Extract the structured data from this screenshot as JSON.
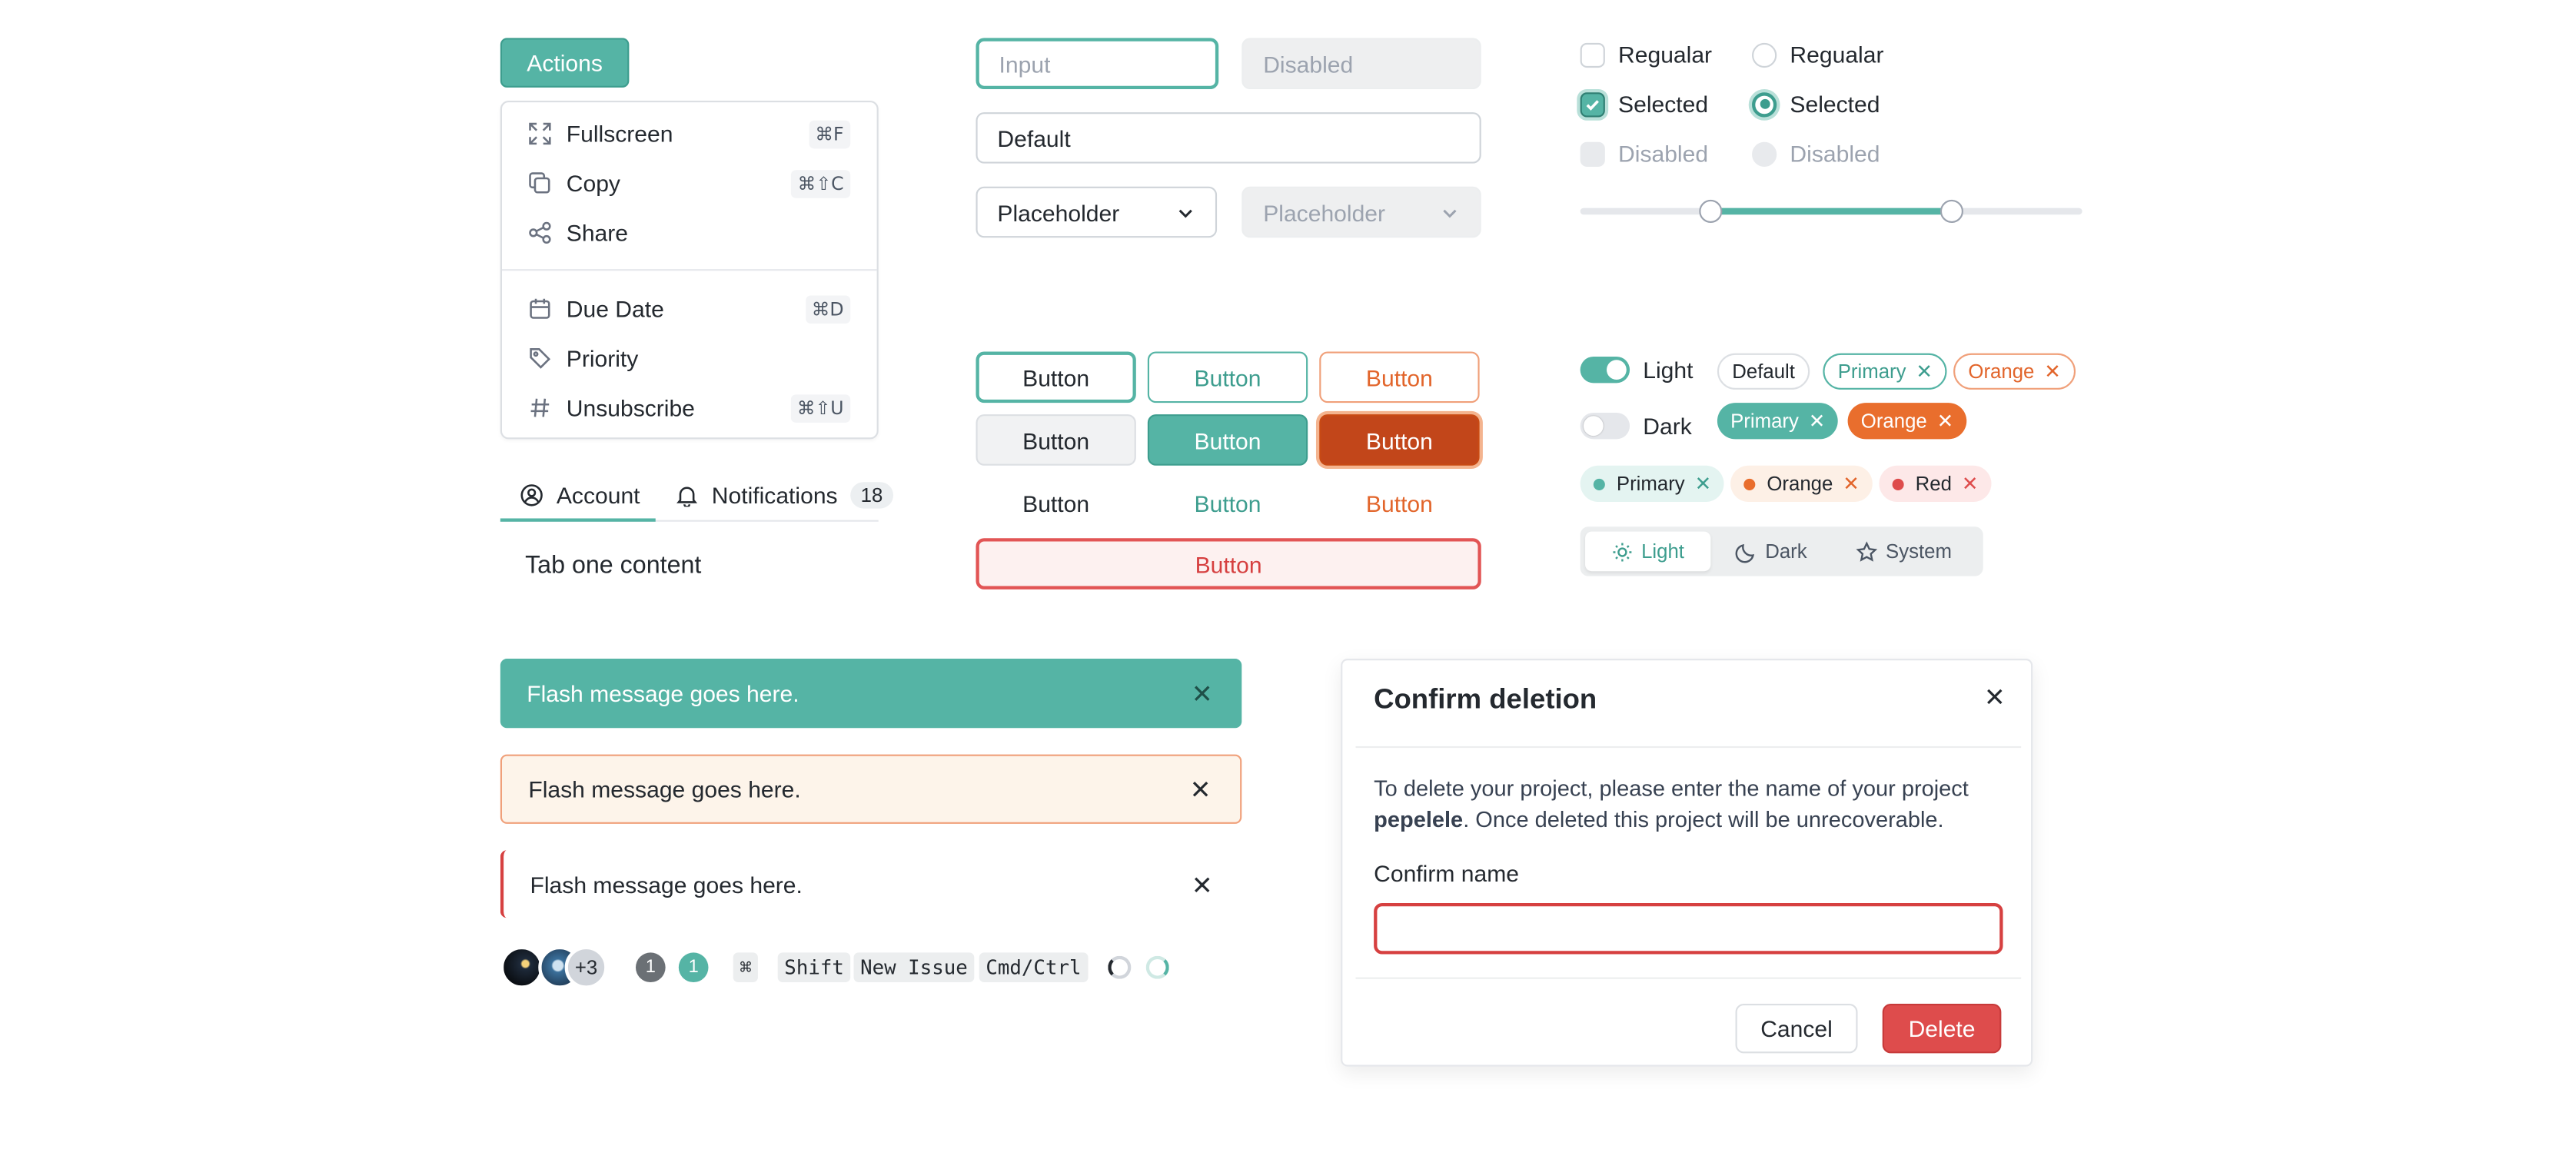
{
  "actions_menu": {
    "button_label": "Actions",
    "items": [
      {
        "label": "Fullscreen",
        "shortcut": "⌘F",
        "icon": "expand-icon"
      },
      {
        "label": "Copy",
        "shortcut": "⌘⇧C",
        "icon": "copy-icon"
      },
      {
        "label": "Share",
        "shortcut": "",
        "icon": "share-icon"
      },
      {
        "label": "Due Date",
        "shortcut": "⌘D",
        "icon": "calendar-icon"
      },
      {
        "label": "Priority",
        "shortcut": "",
        "icon": "tag-icon"
      },
      {
        "label": "Unsubscribe",
        "shortcut": "⌘⇧U",
        "icon": "hash-icon"
      }
    ]
  },
  "tabs": {
    "items": [
      {
        "label": "Account",
        "icon": "user-circle-icon",
        "active": true
      },
      {
        "label": "Notifications",
        "icon": "bell-icon",
        "count": "18"
      }
    ],
    "content": "Tab one content"
  },
  "inputs": {
    "focused_placeholder": "Input",
    "disabled_placeholder": "Disabled",
    "default_value": "Default",
    "select_placeholder": "Placeholder",
    "select_disabled_placeholder": "Placeholder"
  },
  "checkboxes": {
    "regular": "Regualar",
    "selected": "Selected",
    "disabled": "Disabled"
  },
  "radios": {
    "regular": "Regualar",
    "selected": "Selected",
    "disabled": "Disabled"
  },
  "range_slider": {
    "low": 0.26,
    "high": 0.74
  },
  "buttons": {
    "label": "Button"
  },
  "toggles": {
    "light": "Light",
    "dark": "Dark"
  },
  "tags": {
    "default": "Default",
    "primary": "Primary",
    "orange": "Orange",
    "red": "Red",
    "remove_glyph": "✕"
  },
  "theme_switch": {
    "options": [
      "Light",
      "Dark",
      "System"
    ],
    "selected": "Light"
  },
  "flash": {
    "message": "Flash message goes here."
  },
  "bottom_row": {
    "avatar_more": "+3",
    "counter_gray": "1",
    "counter_primary": "1",
    "kbd_cmd": "⌘",
    "kbd_shift": "Shift",
    "kbd_new_issue": "New Issue",
    "kbd_cmd_ctrl": "Cmd/Ctrl"
  },
  "modal": {
    "title": "Confirm deletion",
    "body_prefix": "To delete your project, please enter the name of your project ",
    "project_name": "pepelele",
    "body_suffix": ". Once deleted this project will be unrecoverable.",
    "confirm_label": "Confirm name",
    "cancel_label": "Cancel",
    "delete_label": "Delete"
  },
  "colors": {
    "primary": "#55b4a5",
    "orange": "#e96e2d",
    "danger": "#de4c4c"
  }
}
